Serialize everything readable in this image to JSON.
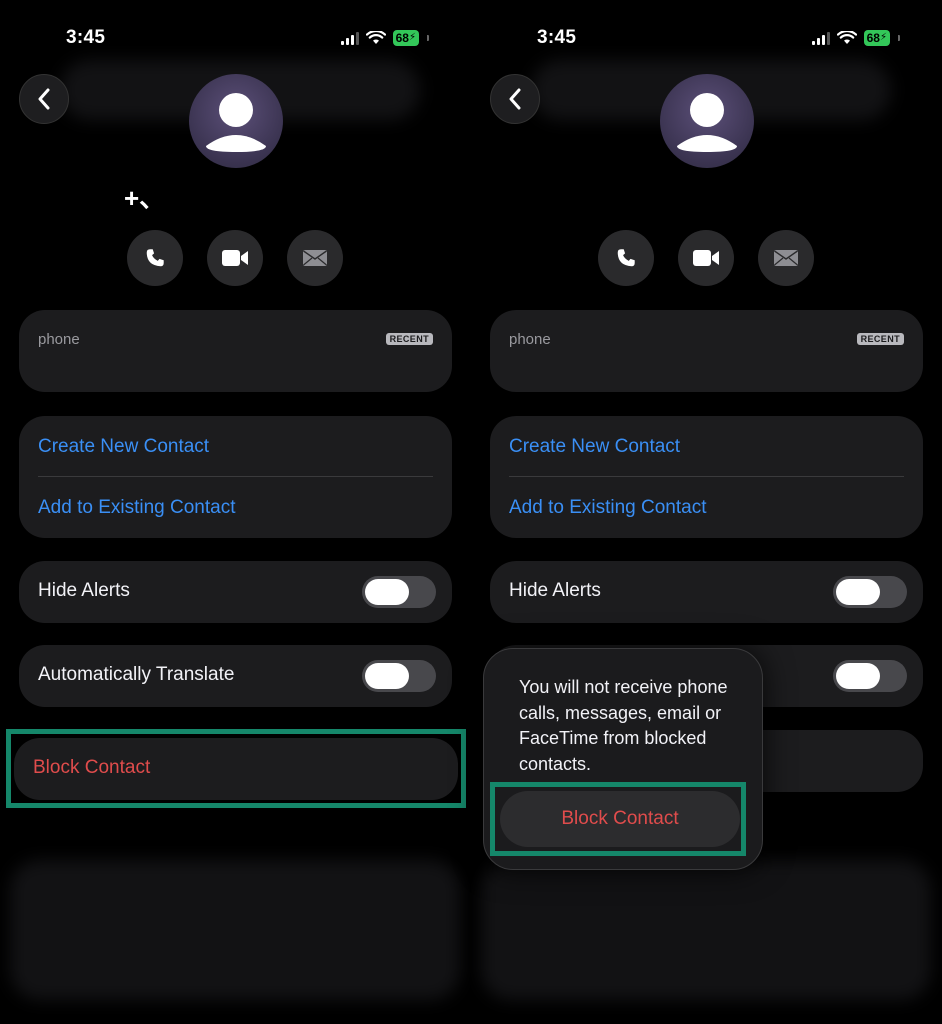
{
  "status": {
    "time": "3:45",
    "battery": "68"
  },
  "contact": {
    "name": "+、"
  },
  "phone_card": {
    "label": "phone",
    "badge": "RECENT"
  },
  "contact_actions": {
    "create": "Create New Contact",
    "add": "Add to Existing Contact"
  },
  "toggles": {
    "hide_alerts": "Hide Alerts",
    "auto_translate": "Automatically Translate"
  },
  "block": {
    "label": "Block Contact"
  },
  "popover": {
    "message": "You will not receive phone calls, messages, email or FaceTime from blocked contacts.",
    "button": "Block Contact"
  },
  "colors": {
    "link": "#3a8ff5",
    "destructive": "#e04c4c",
    "highlight": "#15876a",
    "card": "#1c1c1e"
  }
}
